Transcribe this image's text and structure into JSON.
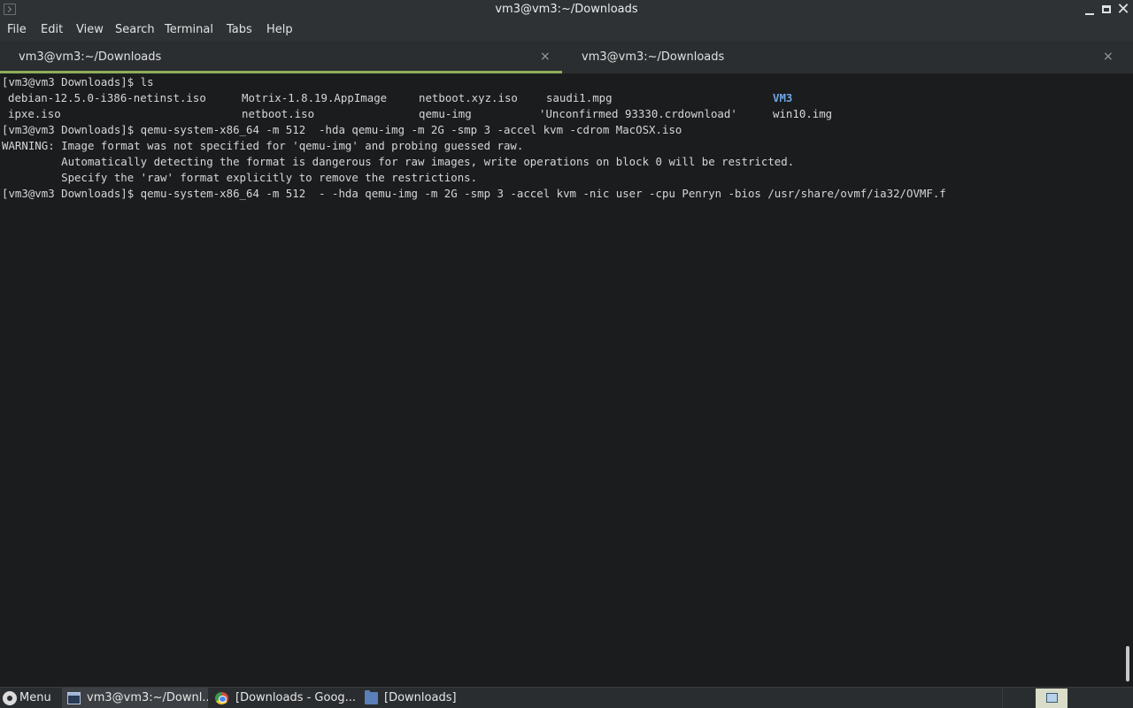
{
  "window": {
    "title": "vm3@vm3:~/Downloads"
  },
  "menubar": {
    "items": [
      "File",
      "Edit",
      "View",
      "Search",
      "Terminal",
      "Tabs",
      "Help"
    ]
  },
  "tabs": [
    {
      "label": "vm3@vm3:~/Downloads",
      "close": "×"
    },
    {
      "label": "vm3@vm3:~/Downloads",
      "close": "×"
    }
  ],
  "terminal": {
    "prompt": "[vm3@vm3 Downloads]$",
    "lines": {
      "l1": "[vm3@vm3 Downloads]$ ls",
      "ls_row1": [
        "debian-12.5.0-i386-netinst.iso",
        "Motrix-1.8.19.AppImage",
        "netboot.xyz.iso",
        "saudi1.mpg",
        "VM3"
      ],
      "ls_row2": [
        "ipxe.iso",
        "netboot.iso",
        "qemu-img",
        "'Unconfirmed 93330.crdownload'",
        "win10.img"
      ],
      "l4": "[vm3@vm3 Downloads]$ qemu-system-x86_64 -m 512  -hda qemu-img -m 2G -smp 3 -accel kvm -cdrom MacOSX.iso",
      "l5": "WARNING: Image format was not specified for 'qemu-img' and probing guessed raw.",
      "l6": "         Automatically detecting the format is dangerous for raw images, write operations on block 0 will be restricted.",
      "l7": "         Specify the 'raw' format explicitly to remove the restrictions.",
      "l8": "[vm3@vm3 Downloads]$ qemu-system-x86_64 -m 512  - -hda qemu-img -m 2G -smp 3 -accel kvm -nic user -cpu Penryn -bios /usr/share/ovmf/ia32/OVMF.f"
    },
    "colors": {
      "background": "#1a1c1e",
      "text": "#d6d6d6",
      "directory": "#6fa6e8"
    }
  },
  "taskbar": {
    "menu_label": "Menu",
    "items": [
      {
        "label": "vm3@vm3:~/Downl...",
        "icon": "terminal-icon"
      },
      {
        "label": "[Downloads - Goog...",
        "icon": "chrome-icon"
      },
      {
        "label": "[Downloads]",
        "icon": "folder-icon"
      }
    ]
  }
}
